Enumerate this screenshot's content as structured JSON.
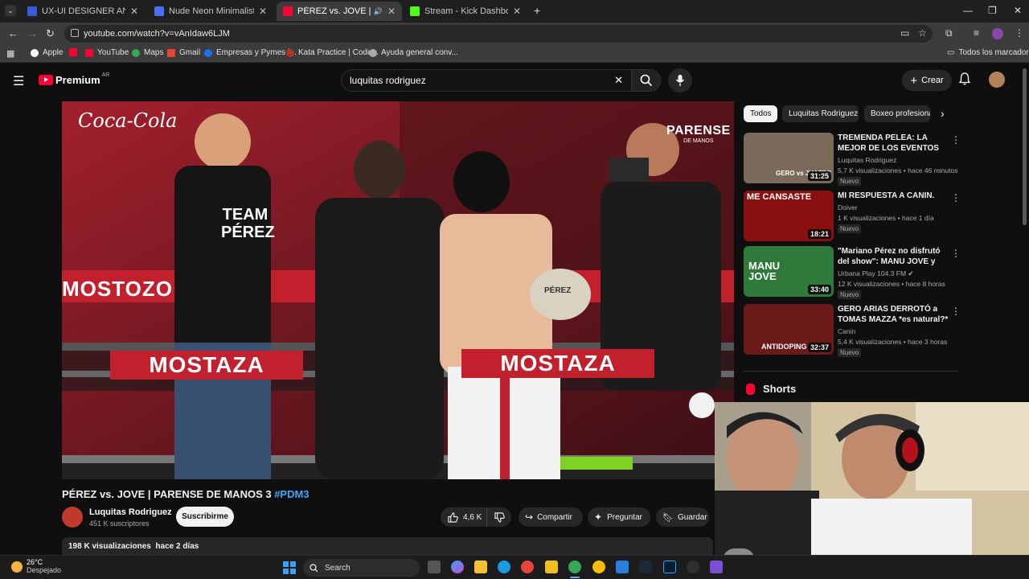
{
  "browser": {
    "tabs": [
      {
        "title": "UX-UI DESIGNER AND FRONTE",
        "favicon_color": "#3b5bdb",
        "active": false
      },
      {
        "title": "Nude Neon Minimalist Marketi",
        "favicon_color": "#4c6ef5",
        "active": false
      },
      {
        "title": "PÉREZ vs. JOVE | PARENSE D",
        "favicon_color": "#ff0033",
        "active": true
      },
      {
        "title": "Stream - Kick Dashboard",
        "favicon_color": "#53fc18",
        "active": false
      }
    ],
    "url": "youtube.com/watch?v=vAnIdaw6LJM",
    "bookmarks": [
      {
        "label": "Apple",
        "color": "#ffffff"
      },
      {
        "label": "",
        "color": "#ff0033"
      },
      {
        "label": "YouTube",
        "color": "#ff0033"
      },
      {
        "label": "Maps",
        "color": "#34a853"
      },
      {
        "label": "Gmail",
        "color": "#ea4335"
      },
      {
        "label": "Empresas y Pymes |...",
        "color": "#1a73e8"
      },
      {
        "label": "Kata Practice | Code...",
        "color": "#b1361e"
      },
      {
        "label": "Ayuda general conv...",
        "color": "#aaaaaa"
      }
    ],
    "all_bookmarks_label": "Todos los marcadores"
  },
  "youtube": {
    "logo_text": "Premium",
    "region": "AR",
    "search_query": "luquitas rodriguez",
    "create_label": "Crear"
  },
  "player": {
    "sponsor_left": "Coca-Cola",
    "sponsor_right": "PARENSE",
    "sponsor_right_sub": "DE MANOS",
    "banner": "MOSTOZO",
    "ring_banner_left": "MOSTAZA",
    "ring_banner_right": "MOSTAZA",
    "shirt_text": "TEAM PÉREZ",
    "glove_text": "PÉREZ"
  },
  "video": {
    "title": "PÉREZ vs. JOVE | PARENSE DE MANOS 3",
    "hashtag": "#PDM3",
    "channel": "Luquitas Rodriguez",
    "subscribers": "451 K suscriptores",
    "subscribe_label": "Suscribirme",
    "likes": "4,6 K",
    "share_label": "Compartir",
    "ask_label": "Preguntar",
    "save_label": "Guardar",
    "views": "198 K visualizaciones",
    "age": "hace 2 días"
  },
  "sidebar": {
    "chips": [
      "Todos",
      "Luquitas Rodriguez",
      "Boxeo profesional"
    ],
    "recommendations": [
      {
        "title": "TREMENDA PELEA: LA MEJOR DE LOS EVENTOS DE PELEAS?",
        "channel": "Luquitas Rodriguez",
        "views": "5,7 K visualizaciones",
        "age": "hace 46 minutos",
        "badge": "Nuevo",
        "duration": "31:25",
        "thumb_text": "GERO vs JUAZPO",
        "thumb_color": "#7a6a5a"
      },
      {
        "title": "MI RESPUESTA A CANIN.",
        "channel": "Doiver",
        "views": "1 K visualizaciones",
        "age": "hace 1 día",
        "badge": "Nuevo",
        "duration": "18:21",
        "thumb_text": "ME CANSASTE",
        "thumb_color": "#8a1010"
      },
      {
        "title": "\"Mariano Pérez no disfrutó del show\": MANU JOVE y Agustín...",
        "channel": "Urbana Play 104.3 FM",
        "views": "12 K visualizaciones",
        "age": "hace 8 horas",
        "badge": "Nuevo",
        "duration": "33:40",
        "thumb_text": "MANU JOVE",
        "thumb_color": "#2f7a3a"
      },
      {
        "title": "GERO ARIAS DERROTÓ a TOMAS MAZZA *es natural?*",
        "channel": "Canin",
        "views": "5,4 K visualizaciones",
        "age": "hace 3 horas",
        "badge": "Nuevo",
        "duration": "32:37",
        "thumb_text": "ANTIDOPING",
        "thumb_color": "#6b1a1a"
      }
    ],
    "shorts_label": "Shorts"
  },
  "taskbar": {
    "temperature": "26°C",
    "condition": "Despejado",
    "search_label": "Search"
  }
}
